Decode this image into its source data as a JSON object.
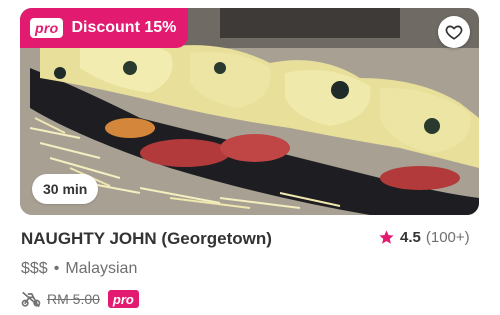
{
  "promo": {
    "pro_label": "pro",
    "text": "Discount 15%"
  },
  "favorite": {
    "icon": "heart-outline-icon"
  },
  "hero": {
    "alt": ""
  },
  "delivery_time": "30 min",
  "restaurant": {
    "name": "NAUGHTY JOHN (Georgetown)",
    "price_level": "$$$",
    "separator": "•",
    "cuisine": "Malaysian"
  },
  "rating": {
    "icon": "star-icon",
    "score": "4.5",
    "count": "(100+)"
  },
  "delivery_fee": {
    "icon": "scooter-icon",
    "old_fee": "RM 5.00",
    "pro_label": "pro"
  },
  "colors": {
    "brand": "#e21b70",
    "text": "#333333",
    "muted": "#707070"
  }
}
